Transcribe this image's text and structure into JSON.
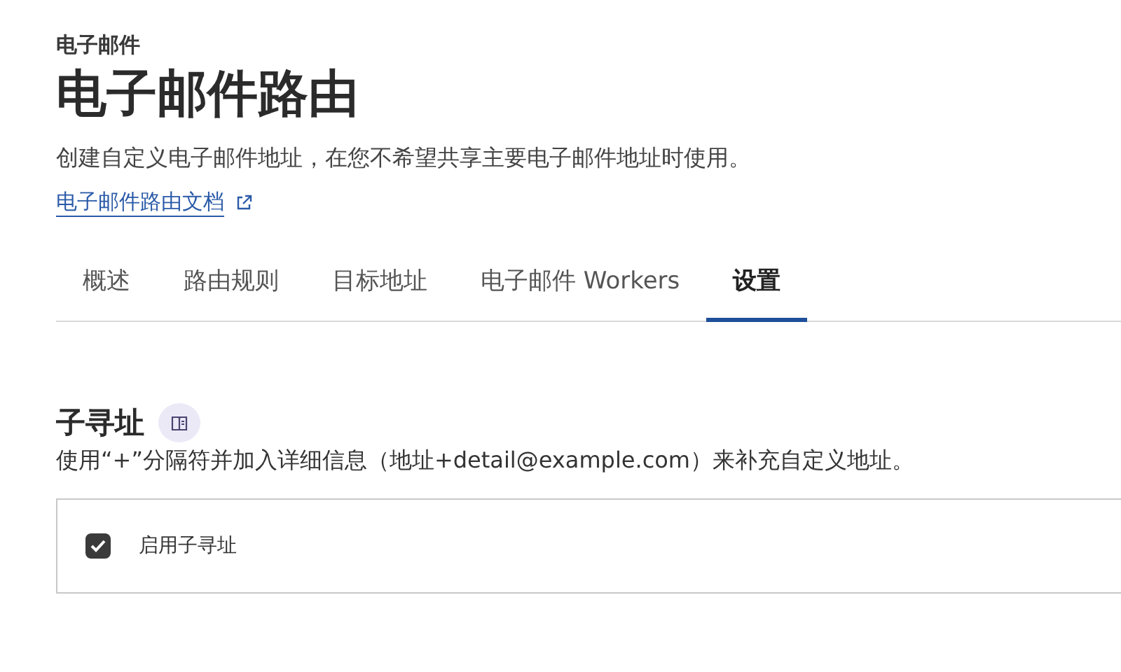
{
  "breadcrumb": "电子邮件",
  "title": "电子邮件路由",
  "description": "创建自定义电子邮件地址，在您不希望共享主要电子邮件地址时使用。",
  "doc_link": "电子邮件路由文档",
  "tabs": [
    {
      "label": "概述",
      "selected": false
    },
    {
      "label": "路由规则",
      "selected": false
    },
    {
      "label": "目标地址",
      "selected": false
    },
    {
      "label": "电子邮件 Workers",
      "selected": false
    },
    {
      "label": "设置",
      "selected": true
    }
  ],
  "section": {
    "title": "子寻址",
    "description": "使用“+”分隔符并加入详细信息（地址+detail@example.com）来补充自定义地址。",
    "option": {
      "label": "启用子寻址",
      "checked": true
    }
  }
}
